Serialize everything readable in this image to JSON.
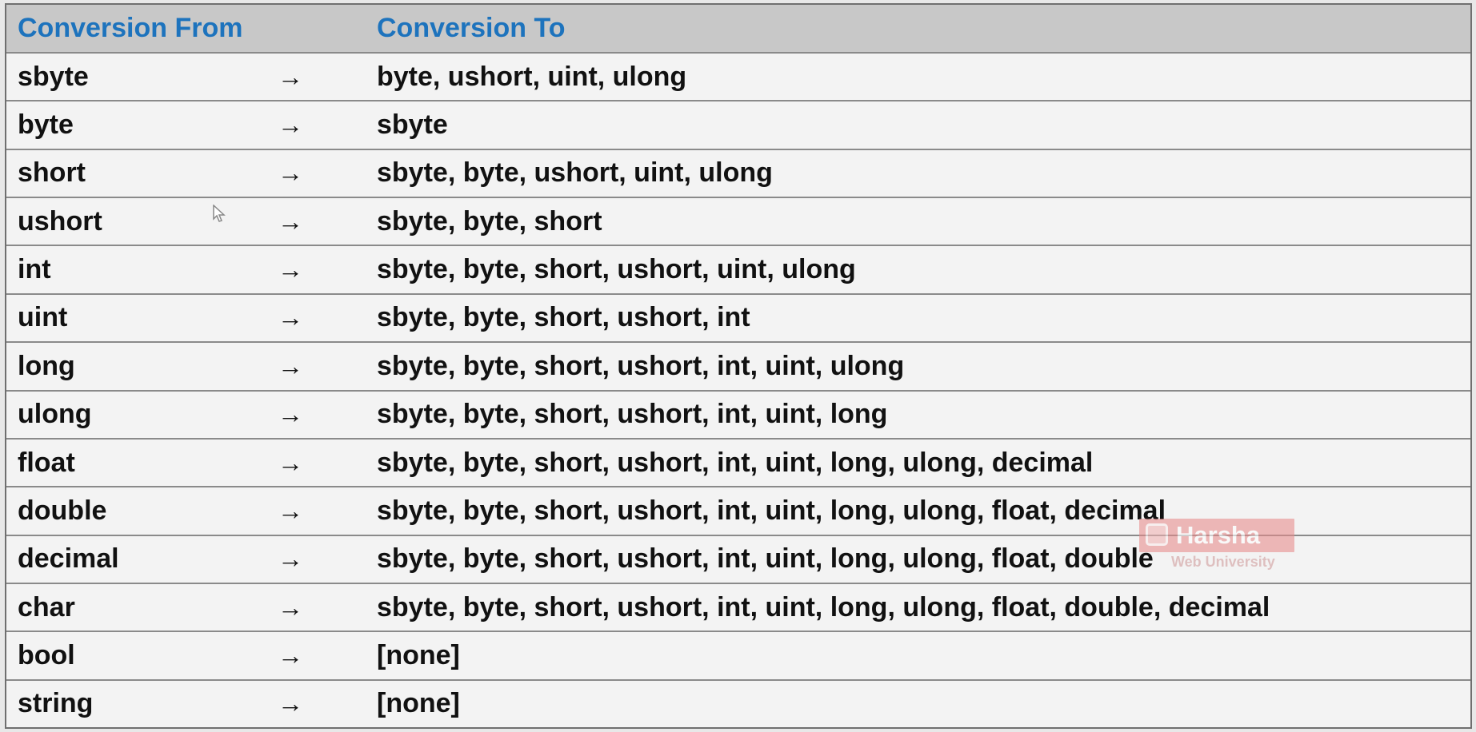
{
  "table": {
    "headers": {
      "from": "Conversion From",
      "to": "Conversion To"
    },
    "rows": [
      {
        "from": "sbyte",
        "arrow": "→",
        "to": "byte, ushort, uint, ulong"
      },
      {
        "from": "byte",
        "arrow": "→",
        "to": "sbyte"
      },
      {
        "from": "short",
        "arrow": "→",
        "to": "sbyte, byte, ushort, uint, ulong"
      },
      {
        "from": "ushort",
        "arrow": "→",
        "to": "sbyte, byte, short"
      },
      {
        "from": "int",
        "arrow": "→",
        "to": "sbyte, byte, short, ushort, uint, ulong"
      },
      {
        "from": "uint",
        "arrow": "→",
        "to": "sbyte, byte, short, ushort, int"
      },
      {
        "from": "long",
        "arrow": "→",
        "to": "sbyte, byte, short, ushort, int, uint, ulong"
      },
      {
        "from": "ulong",
        "arrow": "→",
        "to": "sbyte, byte, short, ushort, int, uint, long"
      },
      {
        "from": "float",
        "arrow": "→",
        "to": "sbyte, byte, short, ushort, int, uint, long, ulong, decimal"
      },
      {
        "from": "double",
        "arrow": "→",
        "to": "sbyte, byte, short, ushort, int, uint, long, ulong, float, decimal"
      },
      {
        "from": "decimal",
        "arrow": "→",
        "to": "sbyte, byte, short, ushort, int, uint, long, ulong, float, double"
      },
      {
        "from": "char",
        "arrow": "→",
        "to": "sbyte, byte, short, ushort, int, uint, long, ulong, float, double, decimal"
      },
      {
        "from": "bool",
        "arrow": "→",
        "to": "[none]"
      },
      {
        "from": "string",
        "arrow": "→",
        "to": "[none]"
      }
    ]
  },
  "watermark": {
    "title": "Harsha",
    "subtitle": "Web University"
  },
  "colors": {
    "header_text": "#1d73bd",
    "header_background": "#c8c8c8",
    "body_background": "#f3f3f3",
    "body_text": "#111111"
  }
}
